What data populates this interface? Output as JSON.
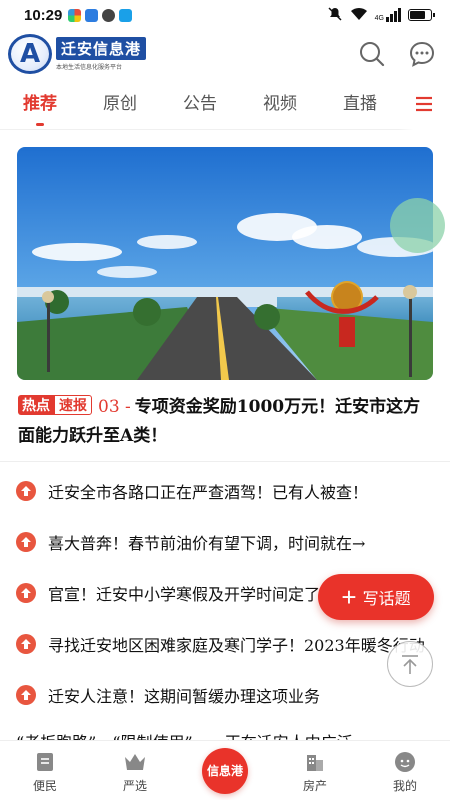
{
  "status_bar": {
    "time": "10:29",
    "network": "4G",
    "battery_level": 0.8
  },
  "header": {
    "logo_letter": "A",
    "logo_title": "迁安信息港",
    "logo_subtitle": "本地生活信息化服务平台"
  },
  "tabs": [
    {
      "label": "推荐",
      "active": true
    },
    {
      "label": "原创",
      "active": false
    },
    {
      "label": "公告",
      "active": false
    },
    {
      "label": "视频",
      "active": false
    },
    {
      "label": "直播",
      "active": false
    }
  ],
  "headline": {
    "tag_hot": "热点",
    "tag_fast": "速报",
    "number": "03 -",
    "title": "专项资金奖励1000万元！迁安市这方面能力跃升至A类！"
  },
  "news": [
    {
      "title": "迁安全市各路口正在严查酒驾！已有人被查！"
    },
    {
      "title": "喜大普奔！春节前油价有望下调，时间就在→"
    },
    {
      "title": "官宣！迁安中小学寒假及开学时间定了"
    },
    {
      "title": "寻找迁安地区困难家庭及寒门学子！2023年暖冬行动"
    },
    {
      "title": "迁安人注意！这期间暂缓办理这项业务"
    }
  ],
  "partial_row": "“老板跑路”、“限制使用”……正在迁安人中广泛",
  "fab": {
    "label": "写话题"
  },
  "bottom_nav": {
    "items": [
      {
        "label": "便民"
      },
      {
        "label": "严选"
      },
      {
        "label": "房产"
      },
      {
        "label": "我的"
      }
    ],
    "center_label": "信息港"
  },
  "colors": {
    "accent": "#e9332a",
    "brand_blue": "#1f4fa3"
  }
}
